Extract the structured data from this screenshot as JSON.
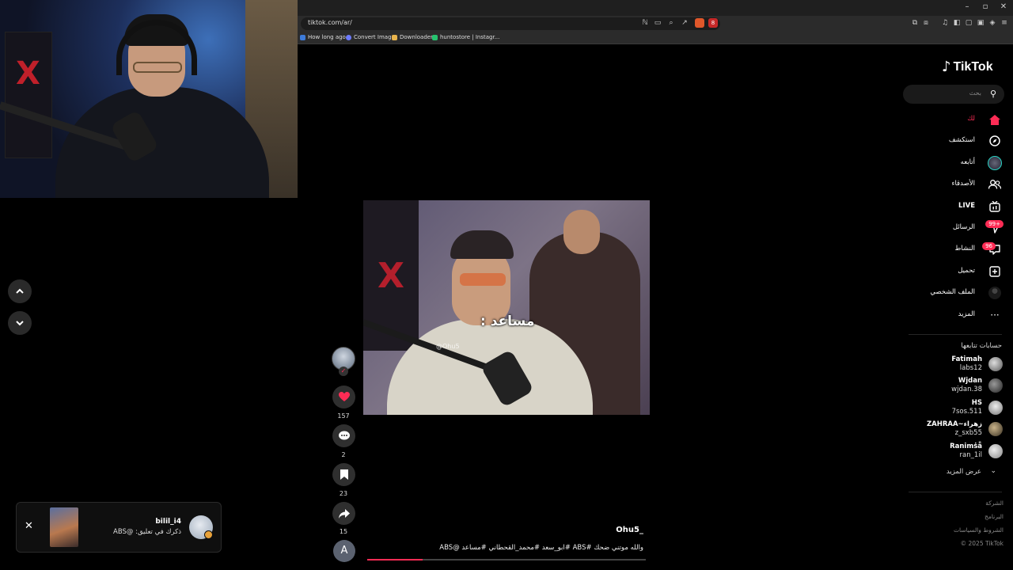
{
  "browser": {
    "url": "tiktok.com/ar/",
    "window_controls": [
      "–",
      "▫",
      "✕"
    ],
    "bookmarks": [
      {
        "label": "How long ago",
        "icon": "globe-icon"
      },
      {
        "label": "Convert Image",
        "icon": "convert-icon"
      },
      {
        "label": "Downloader",
        "icon": "download-icon"
      },
      {
        "label": "huntostore | Instagr...",
        "icon": "instagram-icon"
      }
    ],
    "extension_badge": "8"
  },
  "sidebar": {
    "logo": "TikTok",
    "search_placeholder": "بحث",
    "nav": [
      {
        "label": "لك",
        "icon": "home-icon",
        "active": true
      },
      {
        "label": "استكشف",
        "icon": "compass-icon"
      },
      {
        "label": "أتابعه",
        "icon": "following-avatar-icon"
      },
      {
        "label": "الأصدقاء",
        "icon": "friends-icon"
      },
      {
        "label": "LIVE",
        "icon": "live-icon"
      },
      {
        "label": "الرسائل",
        "icon": "messages-icon",
        "badge": "99+"
      },
      {
        "label": "النشاط",
        "icon": "activity-icon",
        "badge": "96"
      },
      {
        "label": "تحميل",
        "icon": "upload-icon"
      },
      {
        "label": "الملف الشخصي",
        "icon": "profile-icon"
      },
      {
        "label": "المزيد",
        "icon": "more-icon"
      }
    ],
    "following_title": "حسابات تتابعها",
    "following": [
      {
        "name": "Fatimah",
        "handle": "labs12"
      },
      {
        "name": "Wjdan",
        "handle": "wjdan.38"
      },
      {
        "name": "HS",
        "handle": "7sos.511"
      },
      {
        "name": "ZAHRAA~زهراء",
        "handle": "z_sxb55"
      },
      {
        "name": "Ranimṡǟ",
        "handle": "ran_1il"
      }
    ],
    "see_more": "عرض المزيد",
    "footer": [
      "الشركة",
      "البرنامج",
      "الشروط والسياسات",
      "© 2025 TikTok"
    ]
  },
  "video": {
    "caption_overlay": "مساعد :",
    "watermark": "@Ohu5",
    "author": "Ohu5_",
    "description": "والله موتني ضحك #ABS #ابو_سعد #محمد_القحطاني #مساعد @ABS",
    "progress": 0.2,
    "likes": "157",
    "comments": "2",
    "saves": "23",
    "shares": "15",
    "a_button": "A"
  },
  "notification": {
    "user": "bilil_i4",
    "text": "ذكرك في تعليق: @ABS",
    "close": "✕"
  },
  "colors": {
    "accent": "#fe2c55",
    "background": "#000000"
  }
}
